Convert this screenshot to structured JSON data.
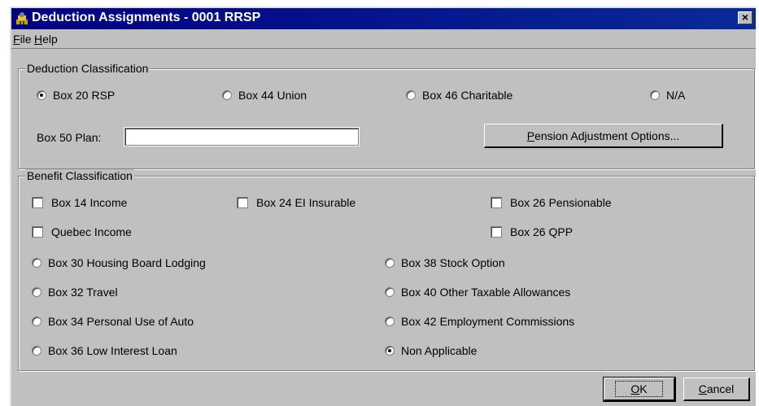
{
  "window": {
    "title": "Deduction Assignments - 0001 RRSP",
    "close_glyph": "×"
  },
  "menu": [
    {
      "label": "File",
      "mnemonic": "F",
      "rest": "ile"
    },
    {
      "label": "Help",
      "mnemonic": "H",
      "rest": "elp"
    }
  ],
  "deduction": {
    "legend": "Deduction Classification",
    "options": [
      {
        "label": "Box 20 RSP",
        "selected": true
      },
      {
        "label": "Box 44 Union",
        "selected": false
      },
      {
        "label": "Box 46 Charitable",
        "selected": false
      },
      {
        "label": "N/A",
        "selected": false
      }
    ],
    "box50_label": "Box 50 Plan:",
    "box50_value": "",
    "pension_button": {
      "mnemonic": "P",
      "rest": "ension Adjustment Options..."
    }
  },
  "benefit": {
    "legend": "Benefit Classification",
    "checkboxes": [
      {
        "label": "Box 14 Income",
        "checked": false
      },
      {
        "label": "Box 24 EI Insurable",
        "checked": false
      },
      {
        "label": "Box 26 Pensionable",
        "checked": false
      },
      {
        "label": "Quebec Income",
        "checked": false
      },
      {
        "label": "Box 26 QPP",
        "checked": false
      }
    ],
    "radios": [
      {
        "label": "Box 30 Housing Board Lodging",
        "selected": false
      },
      {
        "label": "Box 38 Stock Option",
        "selected": false
      },
      {
        "label": "Box 32 Travel",
        "selected": false
      },
      {
        "label": "Box 40 Other Taxable Allowances",
        "selected": false
      },
      {
        "label": "Box 34 Personal Use of Auto",
        "selected": false
      },
      {
        "label": "Box 42 Employment Commissions",
        "selected": false
      },
      {
        "label": "Box 36 Low Interest Loan",
        "selected": false
      },
      {
        "label": "Non Applicable",
        "selected": true
      }
    ]
  },
  "buttons": {
    "ok": {
      "mnemonic": "O",
      "rest": "K"
    },
    "cancel": {
      "mnemonic": "C",
      "rest": "ancel"
    }
  }
}
